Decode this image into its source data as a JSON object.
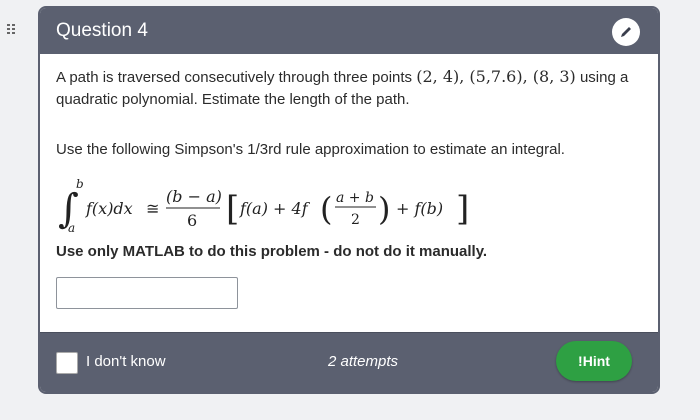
{
  "question": {
    "title": "Question 4",
    "text_before_points": "A path is traversed consecutively through three points ",
    "points": "(2, 4), (5,7.6), (8, 3)",
    "text_after_points": " using a quadratic polynomial. Estimate the length of the path.",
    "instruction": "Use the following Simpson's 1/3rd rule approximation to estimate an integral.",
    "formula": {
      "integral_sign": "∫",
      "upper_limit": "b",
      "lower_limit": "a",
      "integrand": "f(x)dx",
      "approx": "≅",
      "frac_num": "(b − a)",
      "frac_den": "6",
      "left_bracket": "[",
      "term1": "f(a) + 4f",
      "inner_num": "a + b",
      "inner_den": "2",
      "term3": "+ f(b)",
      "right_bracket": "]"
    },
    "warning": "Use only MATLAB to do this problem - do not do it manually.",
    "answer_value": ""
  },
  "footer": {
    "dont_know_label": "I don't know",
    "attempts_label": "2 attempts",
    "hint_label": "!Hint"
  },
  "colors": {
    "header_bg": "#5b6070",
    "hint_bg": "#2ea043"
  },
  "icons": {
    "edit": "pencil-icon",
    "handle": "drag-handle-icon"
  }
}
